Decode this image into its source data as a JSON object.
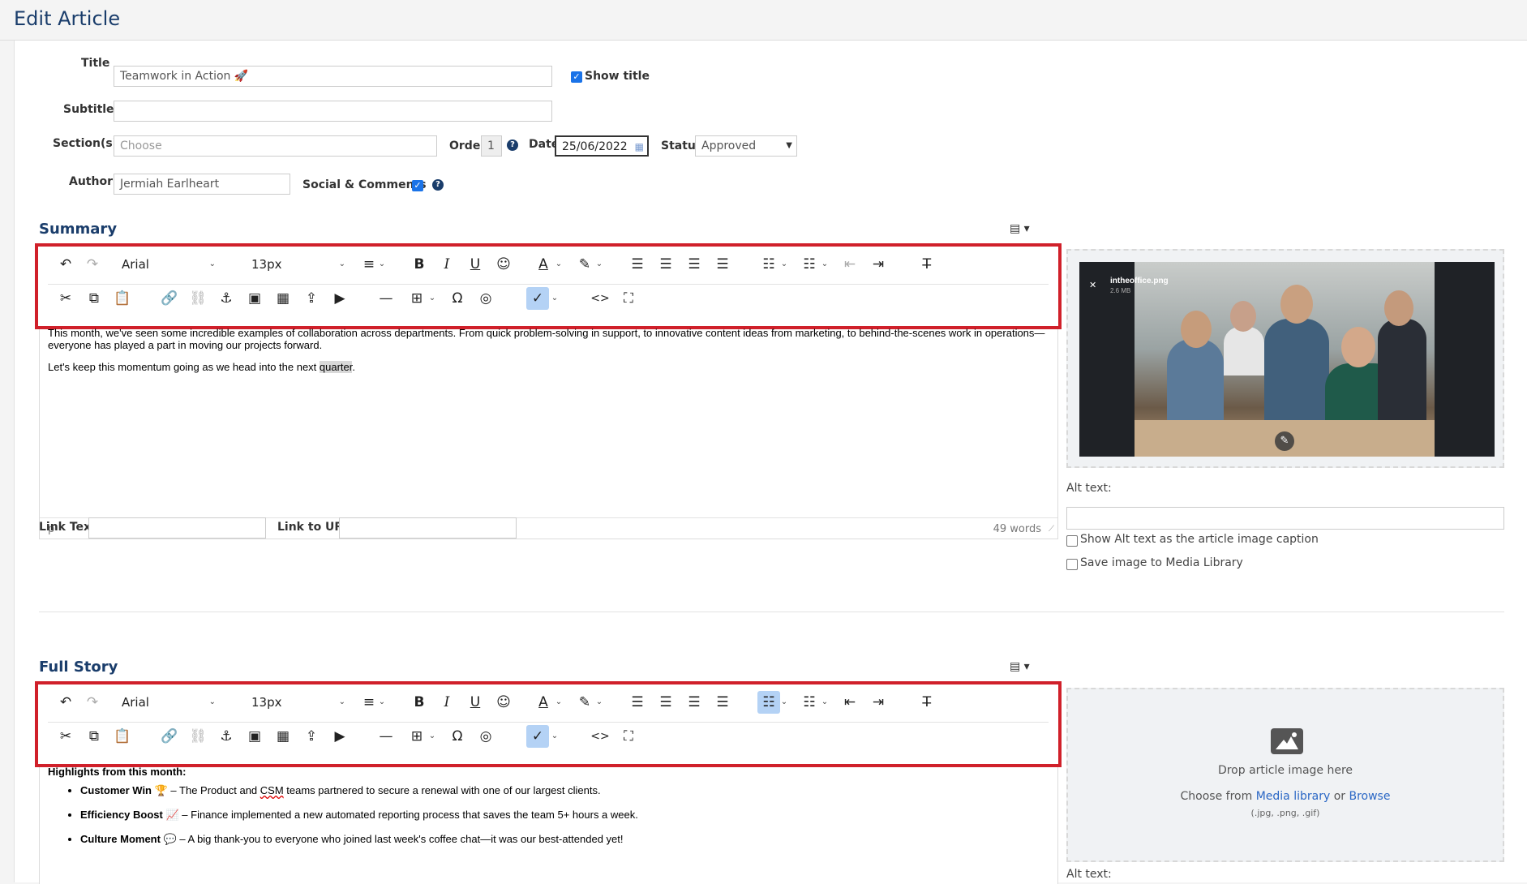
{
  "header": {
    "title": "Edit Article"
  },
  "form": {
    "title_label": "Title",
    "title_value": "Teamwork in Action 🚀",
    "show_title_label": "Show title",
    "subtitle_label": "Subtitle",
    "subtitle_value": "",
    "sections_label": "Section(s)",
    "sections_placeholder": "Choose",
    "order_label": "Order",
    "order_value": "1",
    "date_label": "Date",
    "date_value": "25/06/2022",
    "status_label": "Status",
    "status_value": "Approved",
    "author_label": "Author",
    "author_value": "Jermiah Earlheart",
    "social_label": "Social & Comments"
  },
  "toolbar": {
    "font_family": "Arial",
    "font_size": "13px",
    "icons": {
      "undo": "↶",
      "redo": "↷",
      "line_height": "≡",
      "bold": "B",
      "italic": "I",
      "underline": "U",
      "emoji": "☺",
      "text_color": "A",
      "highlight": "✎",
      "align_left": "☰",
      "align_center": "☰",
      "align_right": "☰",
      "justify": "☰",
      "bullet_list": "☷",
      "numbered_list": "☷",
      "outdent": "⇤",
      "indent": "⇥",
      "clear_format": "T̶",
      "cut": "✂",
      "copy": "⧉",
      "paste": "📋",
      "link": "🔗",
      "unlink": "⛓",
      "anchor": "⚓",
      "image": "▣",
      "media": "▦",
      "upload": "⇪",
      "video": "▶",
      "hr": "—",
      "table": "⊞",
      "special_char": "Ω",
      "target": "◎",
      "spellcheck": "✓",
      "code": "<>",
      "fullscreen": "⛶",
      "caret": "⌄"
    }
  },
  "summary": {
    "title": "Summary",
    "paragraph1": "This month, we've seen some incredible examples of collaboration across departments. From quick problem-solving in support, to innovative content ideas from marketing, to behind-the-scenes work in operations—everyone has played a part in moving our projects forward.",
    "paragraph2_before": "Let's keep this momentum going as we head into the next ",
    "paragraph2_highlight": "quarter",
    "paragraph2_after": ".",
    "path": "p",
    "word_count": "49 words",
    "image": {
      "filename": "intheoffice.png",
      "filesize": "2.6 MB",
      "close": "✕",
      "edit": "✎"
    },
    "alt_text_label": "Alt text:",
    "show_alt_caption": "Show Alt text as the article image caption",
    "save_media": "Save image to Media Library"
  },
  "links": {
    "link_text_label": "Link Text",
    "link_url_label": "Link to URL"
  },
  "full_story": {
    "title": "Full Story",
    "heading": "Highlights from this month:",
    "items": [
      {
        "bold": "Customer Win",
        "emoji": "🏆",
        "pre": " – The Product and ",
        "squig": "CSM",
        "post": " teams partnered to secure a renewal with one of our largest clients."
      },
      {
        "bold": "Efficiency Boost",
        "emoji": "📈",
        "pre": " – Finance implemented a new automated reporting process that saves the team 5+ hours a week.",
        "squig": "",
        "post": ""
      },
      {
        "bold": "Culture Moment",
        "emoji": "💬",
        "pre": " – A big thank-you to everyone who joined last week's coffee chat—it was our best-attended yet!",
        "squig": "",
        "post": ""
      }
    ],
    "drop_text": "Drop article image here",
    "choose_from": "Choose from",
    "media_library": "Media library",
    "or": "or",
    "browse": "Browse",
    "formats": "(.jpg, .png, .gif)",
    "alt_text_label": "Alt text:"
  },
  "colors": {
    "accent": "#1a3d6b",
    "highlight_border": "#d0202a",
    "link": "#2a67c5"
  }
}
